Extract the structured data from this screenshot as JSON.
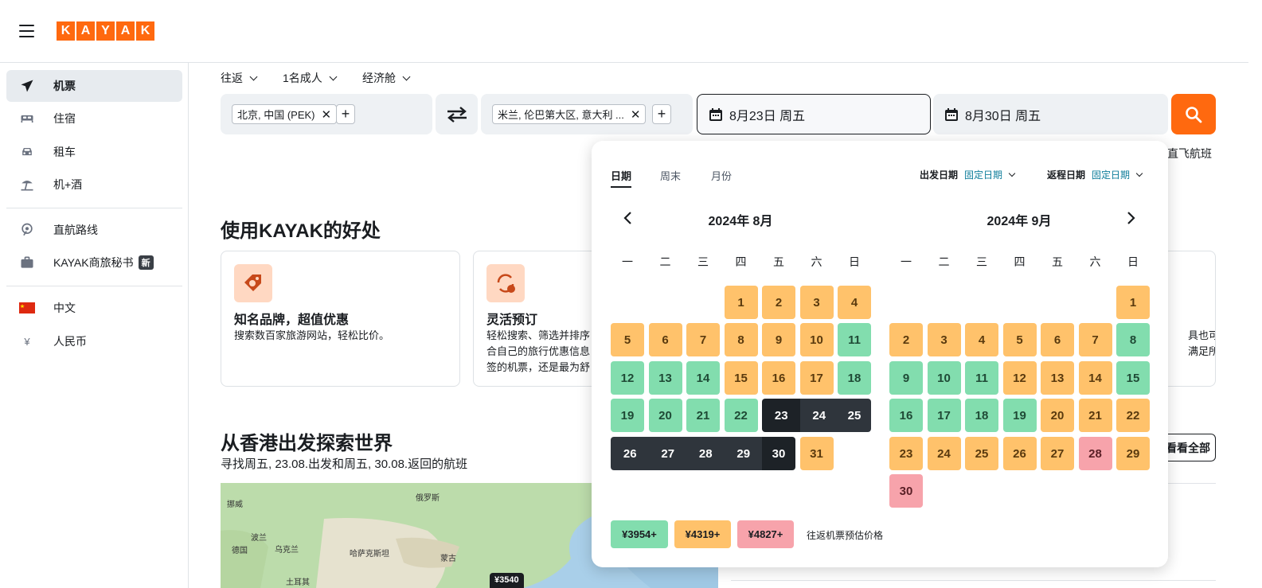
{
  "header": {
    "logo_letters": [
      "K",
      "A",
      "Y",
      "A",
      "K"
    ]
  },
  "sidebar": {
    "items": [
      {
        "label": "机票",
        "icon": "plane-icon"
      },
      {
        "label": "住宿",
        "icon": "bed-icon"
      },
      {
        "label": "租车",
        "icon": "car-icon"
      },
      {
        "label": "机+酒",
        "icon": "beach-umbrella-icon"
      },
      {
        "label": "直航路线",
        "icon": "route-icon"
      },
      {
        "label": "KAYAK商旅秘书",
        "icon": "briefcase-icon",
        "badge": "新"
      },
      {
        "label": "中文",
        "icon": "china-flag-icon"
      },
      {
        "label": "人民币",
        "icon": "yen-icon",
        "symbol": "¥"
      }
    ]
  },
  "filters": {
    "trip_type": "往返",
    "travelers": "1名成人",
    "cabin": "经济舱"
  },
  "search": {
    "origin": "北京, 中国 (PEK)",
    "destination": "米兰, 伦巴第大区, 意大利 ...",
    "depart_date": "8月23日 周五",
    "return_date": "8月30日 周五",
    "direct_hint": "直飞航班"
  },
  "benefits": {
    "title": "使用KAYAK的好处",
    "cards": [
      {
        "title": "知名品牌，超值优惠",
        "desc": [
          "搜索数百家旅游网站，轻松比价。"
        ]
      },
      {
        "title": "灵活预订",
        "desc": [
          "轻松搜索、筛选并排序",
          "合自己的旅行优惠信息",
          "签的机票，还是最为舒"
        ]
      },
      {
        "title": "",
        "desc": [
          "具也可",
          "满足所"
        ]
      }
    ]
  },
  "explore": {
    "title": "从香港出发探索世界",
    "subtitle": "寻找周五, 23.08.出发和周五, 30.08.返回的航班",
    "view_all": "看看全部",
    "map_labels": [
      "挪威",
      "俄罗斯",
      "波兰",
      "乌克兰",
      "哈萨克斯坦",
      "德国",
      "蒙古",
      "土耳其"
    ],
    "map_price": "¥3540"
  },
  "calendar": {
    "tabs": [
      "日期",
      "周末",
      "月份"
    ],
    "active_tab": "日期",
    "depart_label": "出发日期",
    "depart_value": "固定日期",
    "return_label": "返程日期",
    "return_value": "固定日期",
    "weekdays": [
      "一",
      "二",
      "三",
      "四",
      "五",
      "六",
      "日"
    ],
    "months": [
      {
        "title": "2024年 8月",
        "offset": 3,
        "days": [
          "o",
          "o",
          "o",
          "o",
          "o",
          "o",
          "o",
          "o",
          "o",
          "o",
          "g",
          "g",
          "g",
          "g",
          "o",
          "o",
          "o",
          "g",
          "g",
          "g",
          "g",
          "g",
          "sel",
          "sel",
          "sel",
          "sel",
          "sel",
          "sel",
          "sel",
          "sel",
          "o"
        ]
      },
      {
        "title": "2024年 9月",
        "offset": 6,
        "days": [
          "o",
          "o",
          "o",
          "o",
          "o",
          "o",
          "o",
          "g",
          "g",
          "g",
          "g",
          "o",
          "o",
          "o",
          "g",
          "g",
          "g",
          "g",
          "g",
          "o",
          "o",
          "o",
          "o",
          "o",
          "o",
          "o",
          "o",
          "r",
          "o",
          "r"
        ]
      }
    ],
    "legend": [
      {
        "label": "¥3954+",
        "color": "#82ddae"
      },
      {
        "label": "¥4319+",
        "color": "#ffc26b"
      },
      {
        "label": "¥4827+",
        "color": "#f7a3ab"
      }
    ],
    "legend_text": "往返机票预估价格"
  }
}
